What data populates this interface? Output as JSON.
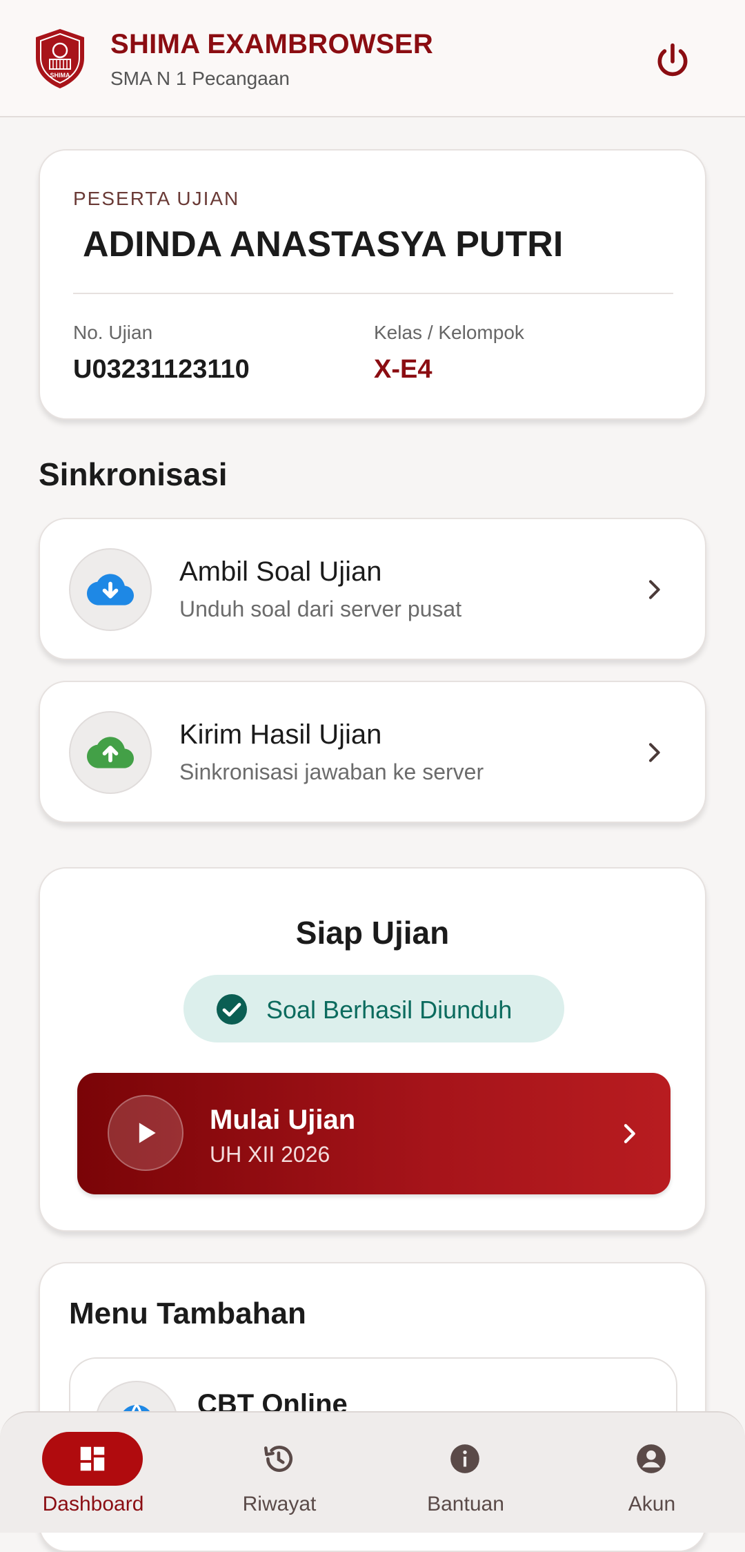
{
  "header": {
    "title": "SHIMA EXAMBROWSER",
    "subtitle": "SMA N 1 Pecangaan",
    "logo_text": "SHIMA"
  },
  "participant": {
    "label": "PESERTA UJIAN",
    "name": "ADINDA ANASTASYA PUTRI",
    "exam_no_label": "No. Ujian",
    "exam_no": "U03231123110",
    "class_label": "Kelas / Kelompok",
    "class": "X-E4"
  },
  "sync": {
    "section_title": "Sinkronisasi",
    "items": [
      {
        "title": "Ambil Soal Ujian",
        "subtitle": "Unduh soal dari server pusat",
        "icon": "cloud-download-icon"
      },
      {
        "title": "Kirim Hasil Ujian",
        "subtitle": "Sinkronisasi jawaban ke server",
        "icon": "cloud-upload-icon"
      }
    ]
  },
  "ready": {
    "title": "Siap Ujian",
    "status": "Soal Berhasil Diunduh",
    "start_title": "Mulai Ujian",
    "start_subtitle": "UH XII 2026"
  },
  "extra": {
    "title": "Menu Tambahan",
    "items": [
      {
        "title": "CBT Online"
      }
    ]
  },
  "nav": {
    "items": [
      {
        "label": "Dashboard",
        "icon": "dashboard-icon",
        "active": true
      },
      {
        "label": "Riwayat",
        "icon": "history-icon",
        "active": false
      },
      {
        "label": "Bantuan",
        "icon": "info-icon",
        "active": false
      },
      {
        "label": "Akun",
        "icon": "account-icon",
        "active": false
      }
    ]
  },
  "colors": {
    "brand": "#8b0d12",
    "status_bg": "#dcefec",
    "status_text": "#0b6b5e",
    "download_icon": "#1e88e5",
    "upload_icon": "#43a047"
  }
}
